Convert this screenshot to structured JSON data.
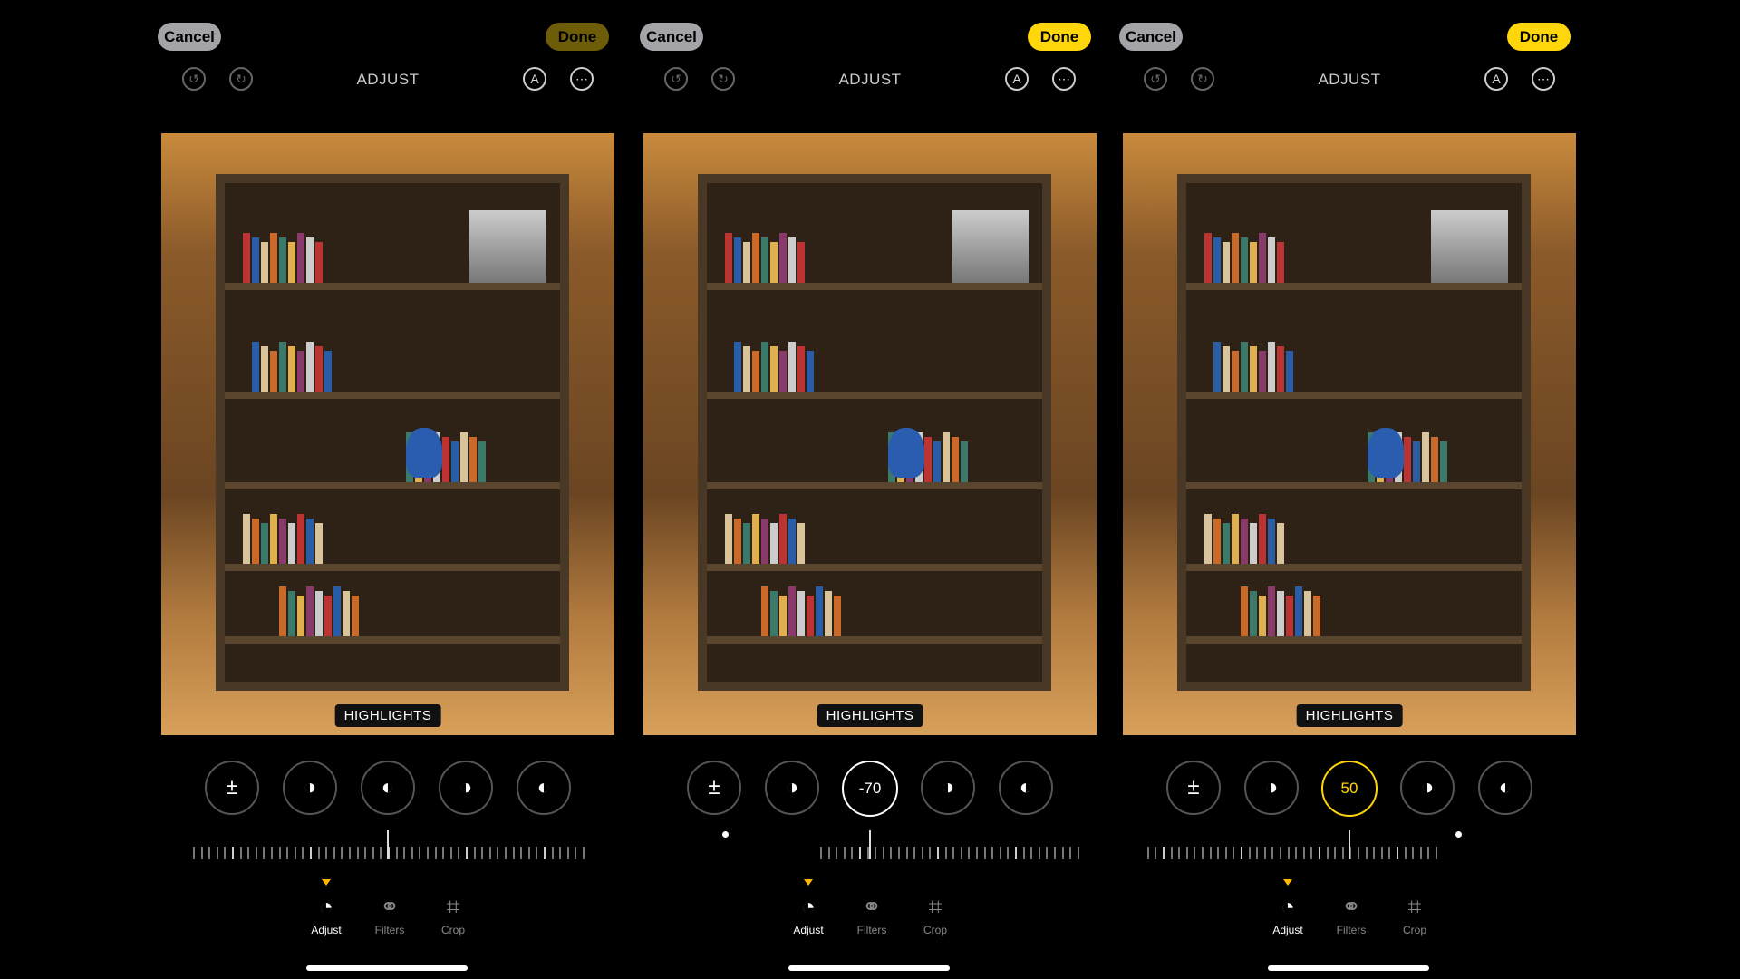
{
  "panels": [
    {
      "cancel": "Cancel",
      "done": "Done",
      "done_active": false,
      "title": "ADJUST",
      "label": "HIGHLIGHTS",
      "selected_value": "",
      "selected_style": "none",
      "slider_value": 0
    },
    {
      "cancel": "Cancel",
      "done": "Done",
      "done_active": true,
      "title": "ADJUST",
      "label": "HIGHLIGHTS",
      "selected_value": "-70",
      "selected_style": "white",
      "slider_value": -70
    },
    {
      "cancel": "Cancel",
      "done": "Done",
      "done_active": true,
      "title": "ADJUST",
      "label": "HIGHLIGHTS",
      "selected_value": "50",
      "selected_style": "yellow",
      "slider_value": 50
    }
  ],
  "tools": [
    {
      "name": "exposure-icon",
      "glyph": "±"
    },
    {
      "name": "brilliance-icon",
      "glyph": "◑"
    },
    {
      "name": "highlights-icon",
      "glyph": "◐"
    },
    {
      "name": "shadows-icon",
      "glyph": "◑"
    },
    {
      "name": "contrast-icon",
      "glyph": "◐"
    }
  ],
  "tabs": [
    {
      "label": "Adjust",
      "icon": "adjust-dial-icon",
      "glyph": "◔",
      "active": true
    },
    {
      "label": "Filters",
      "icon": "filters-icon",
      "glyph": "⚭",
      "active": false
    },
    {
      "label": "Crop",
      "icon": "crop-rotate-icon",
      "glyph": "⌗",
      "active": false
    }
  ],
  "colors": {
    "accent": "#ffd60a",
    "indicator": "#ffb800"
  }
}
